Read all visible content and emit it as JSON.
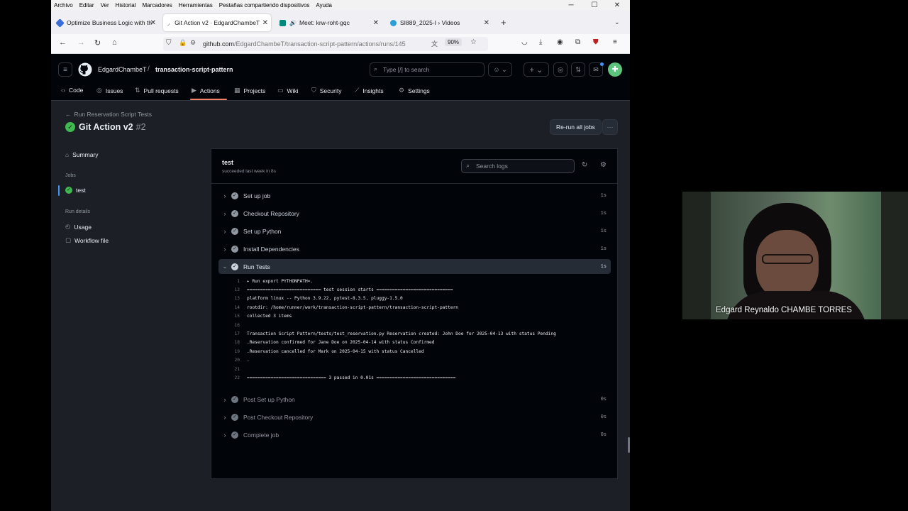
{
  "browser": {
    "menu": [
      "Archivo",
      "Editar",
      "Ver",
      "Historial",
      "Marcadores",
      "Herramientas",
      "Pestañas compartiendo dispositivos",
      "Ayuda"
    ],
    "tabs": [
      {
        "label": "Optimize Business Logic with th"
      },
      {
        "label": "Git Action v2 · EdgardChambeT"
      },
      {
        "label": "Meet: krw-roht-gqc"
      },
      {
        "label": "SI889_2025-I › Videos"
      }
    ],
    "url_host": "github.com",
    "url_path": "/EdgardChambeT/transaction-script-pattern/actions/runs/145",
    "zoom": "90%"
  },
  "github": {
    "owner": "EdgardChambeT",
    "repo": "transaction-script-pattern",
    "search_placeholder": "Type [/] to search",
    "repo_tabs": [
      "Code",
      "Issues",
      "Pull requests",
      "Actions",
      "Projects",
      "Wiki",
      "Security",
      "Insights",
      "Settings"
    ],
    "back_link": "Run Reservation Script Tests",
    "run_title": "Git Action v2",
    "run_number": "#2",
    "rerun_label": "Re-run all jobs",
    "more_label": "···",
    "sidebar": {
      "summary": "Summary",
      "jobs_heading": "Jobs",
      "job": "test",
      "run_details_heading": "Run details",
      "usage": "Usage",
      "workflow_file": "Workflow file"
    },
    "job_panel": {
      "title": "test",
      "subtitle": "succeeded last week in 8s",
      "search_placeholder": "Search logs"
    },
    "steps_before": [
      {
        "name": "Set up job",
        "duration": "1s"
      },
      {
        "name": "Checkout Repository",
        "duration": "1s"
      },
      {
        "name": "Set up Python",
        "duration": "1s"
      },
      {
        "name": "Install Dependencies",
        "duration": "1s"
      }
    ],
    "open_step": {
      "name": "Run Tests",
      "duration": "1s"
    },
    "log_lines": [
      {
        "n": "1",
        "text": "▸ Run export PYTHONPATH=."
      },
      {
        "n": "12",
        "text": "============================ test session starts ============================="
      },
      {
        "n": "13",
        "text": "platform linux -- Python 3.9.22, pytest-8.3.5, pluggy-1.5.0"
      },
      {
        "n": "14",
        "text": "rootdir: /home/runner/work/transaction-script-pattern/transaction-script-pattern"
      },
      {
        "n": "15",
        "text": "collected 3 items"
      },
      {
        "n": "16",
        "text": ""
      },
      {
        "n": "17",
        "text": "Transaction Script Pattern/tests/test_reservation.py Reservation created: John Doe for 2025-04-13 with status Pending"
      },
      {
        "n": "18",
        "text": ".Reservation confirmed for Jane Doe on 2025-04-14 with status Confirmed"
      },
      {
        "n": "19",
        "text": ".Reservation cancelled for Mark on 2025-04-15 with status Cancelled"
      },
      {
        "n": "20",
        "text": "."
      },
      {
        "n": "21",
        "text": ""
      },
      {
        "n": "22",
        "text": "============================== 3 passed in 0.01s =============================="
      }
    ],
    "steps_after": [
      {
        "name": "Post Set up Python",
        "duration": "0s"
      },
      {
        "name": "Post Checkout Repository",
        "duration": "0s"
      },
      {
        "name": "Complete job",
        "duration": "0s"
      }
    ]
  },
  "video": {
    "participant_name": "Edgard Reynaldo CHAMBE TORRES"
  },
  "colors": {
    "success": "#3fb950",
    "accent_underline": "#f78166",
    "gh_bg": "#010409"
  }
}
